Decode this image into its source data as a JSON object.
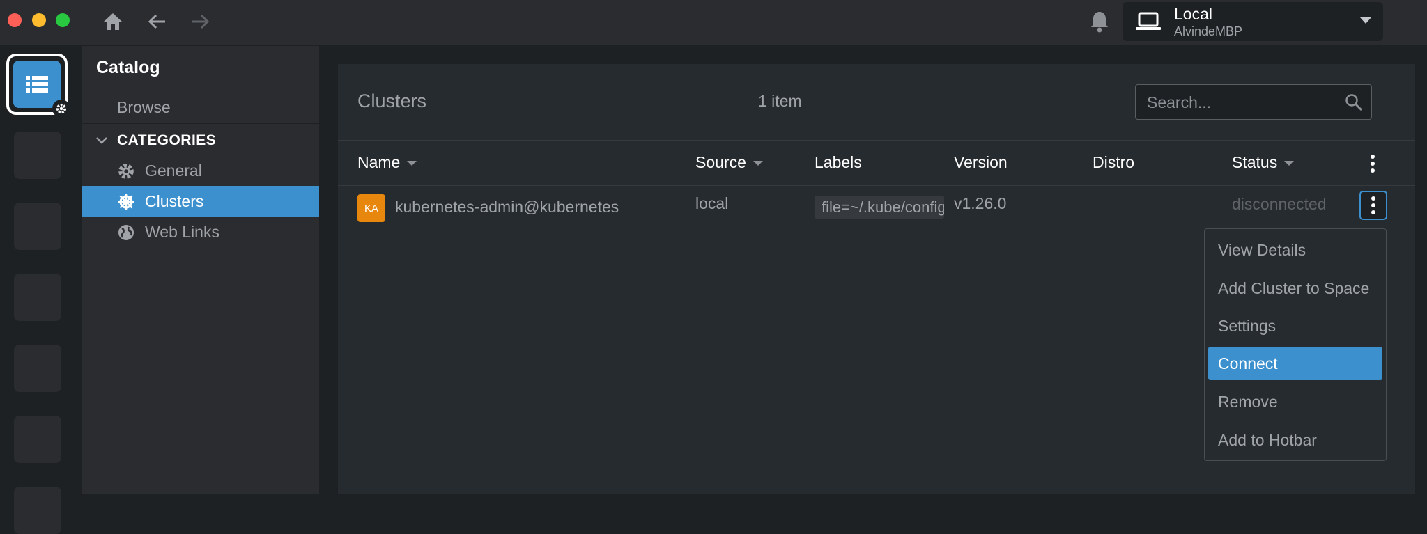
{
  "context": {
    "name": "Local",
    "machine": "AlvindeMBP"
  },
  "sidebar": {
    "title": "Catalog",
    "browse": "Browse",
    "categories_label": "CATEGORIES",
    "items": [
      {
        "label": "General",
        "icon": "gear-icon"
      },
      {
        "label": "Clusters",
        "icon": "helm-icon",
        "active": true
      },
      {
        "label": "Web Links",
        "icon": "globe-icon"
      }
    ]
  },
  "panel": {
    "title": "Clusters",
    "count": "1 item",
    "search_placeholder": "Search..."
  },
  "table": {
    "columns": [
      "Name",
      "Source",
      "Labels",
      "Version",
      "Distro",
      "Status"
    ],
    "rows": [
      {
        "avatar": "KA",
        "name": "kubernetes-admin@kubernetes",
        "source": "local",
        "labels": "file=~/.kube/config",
        "version": "v1.26.0",
        "distro": "",
        "status": "disconnected"
      }
    ]
  },
  "menu": {
    "items": [
      "View Details",
      "Add Cluster to Space",
      "Settings",
      "Connect",
      "Remove",
      "Add to Hotbar"
    ],
    "active": "Connect"
  },
  "colors": {
    "accent": "#3d90ce",
    "avatar": "#e8870d"
  }
}
